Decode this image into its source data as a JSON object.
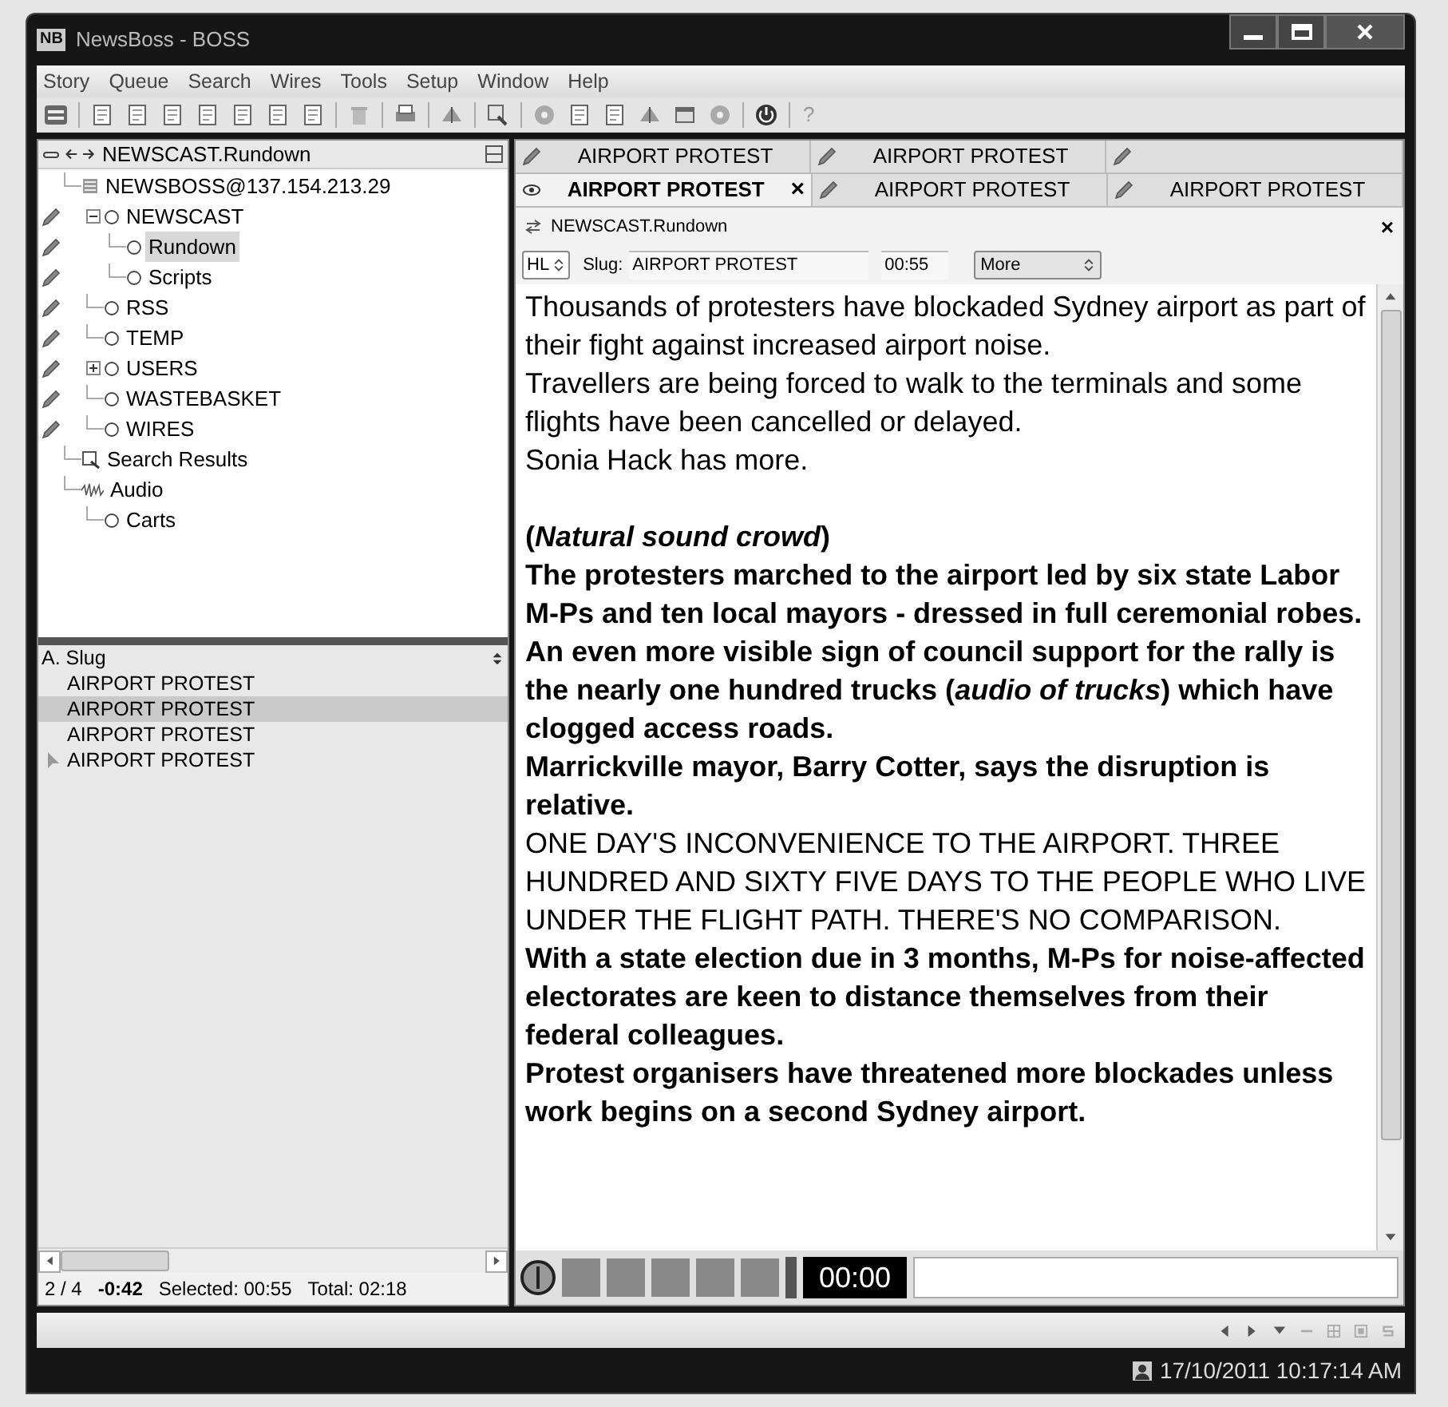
{
  "window": {
    "logo": "NB",
    "title": "NewsBoss - BOSS"
  },
  "menu": [
    "Story",
    "Queue",
    "Search",
    "Wires",
    "Tools",
    "Setup",
    "Window",
    "Help"
  ],
  "toolbar": {
    "help": "?"
  },
  "tree": {
    "path": "NEWSCAST.Rundown",
    "items": [
      {
        "label": "NEWSBOSS@137.154.213.29",
        "kind": "server",
        "children": [
          {
            "label": "NEWSCAST",
            "kind": "queue",
            "editable": true,
            "expanded": true,
            "selected": false,
            "children": [
              {
                "label": "Rundown",
                "kind": "queue",
                "editable": true,
                "selected": true
              },
              {
                "label": "Scripts",
                "kind": "queue",
                "editable": true,
                "selected": false
              }
            ]
          },
          {
            "label": "RSS",
            "kind": "queue",
            "editable": true,
            "selected": false
          },
          {
            "label": "TEMP",
            "kind": "queue",
            "editable": true,
            "selected": false
          },
          {
            "label": "USERS",
            "kind": "queue",
            "editable": true,
            "expanded": false,
            "selected": false
          },
          {
            "label": "WASTEBASKET",
            "kind": "queue",
            "editable": true,
            "selected": false
          },
          {
            "label": "WIRES",
            "kind": "queue",
            "editable": true,
            "selected": false
          }
        ]
      },
      {
        "label": "Search Results",
        "kind": "search"
      },
      {
        "label": "Audio",
        "kind": "audio",
        "children": [
          {
            "label": "Carts",
            "kind": "queue",
            "selected": false
          }
        ]
      }
    ]
  },
  "slug_list": {
    "header": "A. Slug",
    "rows": [
      {
        "slug": "AIRPORT PROTEST",
        "selected": false,
        "marked": false
      },
      {
        "slug": "AIRPORT PROTEST",
        "selected": true,
        "marked": false
      },
      {
        "slug": "AIRPORT PROTEST",
        "selected": false,
        "marked": false
      },
      {
        "slug": "AIRPORT PROTEST",
        "selected": false,
        "marked": true
      }
    ]
  },
  "list_status": {
    "position": "2 / 4",
    "offset": "-0:42",
    "selected": "Selected: 00:55",
    "total": "Total: 02:18"
  },
  "tab_rows": [
    [
      {
        "label": "AIRPORT PROTEST",
        "selected": false
      },
      {
        "label": "AIRPORT PROTEST",
        "selected": false
      },
      {
        "selected": false
      }
    ],
    [
      {
        "label": "AIRPORT PROTEST",
        "selected": true,
        "close": "×"
      },
      {
        "label": "AIRPORT PROTEST",
        "selected": false
      },
      {
        "label": "AIRPORT PROTEST",
        "selected": false
      }
    ]
  ],
  "editor": {
    "queue": "NEWSCAST.Rundown",
    "close": "×",
    "type": "HL",
    "slug_label": "Slug:",
    "slug": "AIRPORT PROTEST",
    "duration": "00:55",
    "more": "More",
    "script": [
      {
        "kind": "read",
        "text": "Thousands of protesters have blockaded Sydney airport as part of their fight against increased airport noise."
      },
      {
        "kind": "read",
        "text": "Travellers are being forced to walk to the terminals and some flights have been cancelled or delayed."
      },
      {
        "kind": "read",
        "text": "Sonia Hack has more."
      },
      {
        "kind": "gap"
      },
      {
        "kind": "bold",
        "text": "(*Natural sound crowd*)"
      },
      {
        "kind": "bold",
        "text": "The protesters marched to the airport led by six state Labor M-Ps and ten local mayors - dressed in full ceremonial robes."
      },
      {
        "kind": "bold",
        "text": "An even more visible sign of council support for the rally is the nearly one hundred trucks (*audio of trucks*) which have clogged access roads."
      },
      {
        "kind": "bold",
        "text": "Marrickville mayor, Barry Cotter, says the disruption is relative."
      },
      {
        "kind": "caps",
        "text": "ONE DAY'S INCONVENIENCE TO THE AIRPORT. THREE HUNDRED AND SIXTY FIVE DAYS TO THE PEOPLE WHO LIVE UNDER THE FLIGHT PATH. THERE'S NO COMPARISON."
      },
      {
        "kind": "bold",
        "text": "With a state election due in 3 months, M-Ps for noise-affected electorates are keen to distance themselves from their federal colleagues."
      },
      {
        "kind": "bold",
        "text": "Protest organisers have threatened more blockades unless work begins on a second Sydney airport."
      }
    ]
  },
  "player": {
    "time": "00:00"
  },
  "status_bar": {
    "datetime": "17/10/2011 10:17:14 AM"
  }
}
